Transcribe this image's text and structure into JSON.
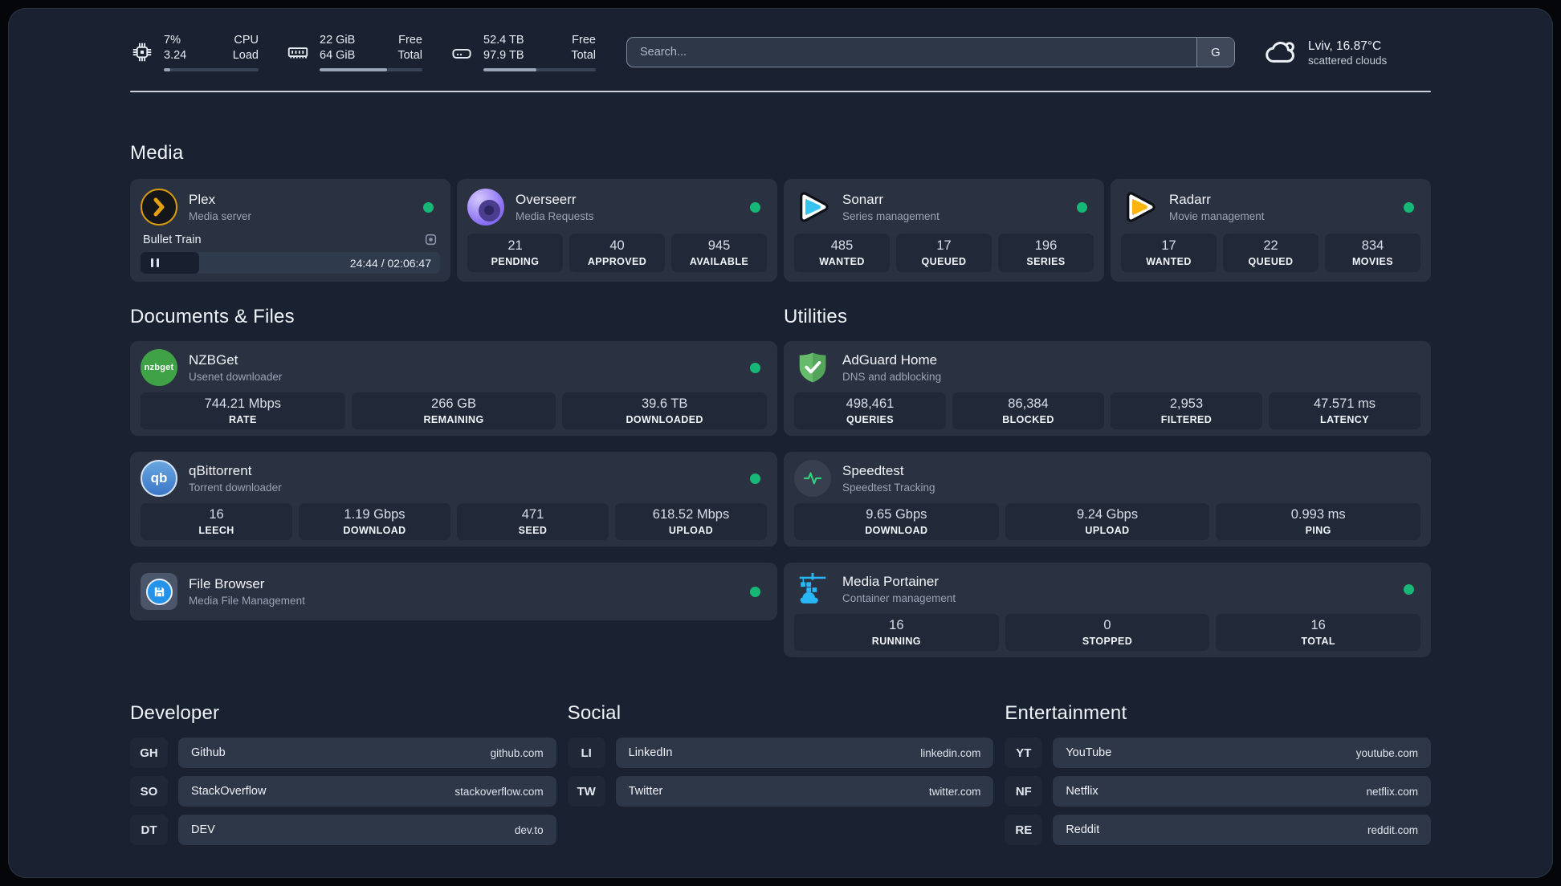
{
  "header": {
    "stats": [
      {
        "icon": "cpu-icon",
        "value_top": "7%",
        "label_top": "CPU",
        "value_bottom": "3.24",
        "label_bottom": "Load",
        "progress": 7
      },
      {
        "icon": "ram-icon",
        "value_top": "22 GiB",
        "label_top": "Free",
        "value_bottom": "64 GiB",
        "label_bottom": "Total",
        "progress": 66
      },
      {
        "icon": "disk-icon",
        "value_top": "52.4 TB",
        "label_top": "Free",
        "value_bottom": "97.9 TB",
        "label_bottom": "Total",
        "progress": 47
      }
    ],
    "search": {
      "placeholder": "Search...",
      "engine_button": "G"
    },
    "weather": {
      "location_temp": "Lviv, 16.87°C",
      "condition": "scattered clouds"
    }
  },
  "media": {
    "title": "Media",
    "plex": {
      "name": "Plex",
      "desc": "Media server",
      "status": "online",
      "now_playing": "Bullet Train",
      "time": "24:44 / 02:06:47",
      "progress": 19.5
    },
    "overseerr": {
      "name": "Overseerr",
      "desc": "Media Requests",
      "status": "online",
      "stats": [
        {
          "value": "21",
          "label": "PENDING"
        },
        {
          "value": "40",
          "label": "APPROVED"
        },
        {
          "value": "945",
          "label": "AVAILABLE"
        }
      ]
    },
    "sonarr": {
      "name": "Sonarr",
      "desc": "Series management",
      "status": "online",
      "stats": [
        {
          "value": "485",
          "label": "WANTED"
        },
        {
          "value": "17",
          "label": "QUEUED"
        },
        {
          "value": "196",
          "label": "SERIES"
        }
      ]
    },
    "radarr": {
      "name": "Radarr",
      "desc": "Movie management",
      "status": "online",
      "stats": [
        {
          "value": "17",
          "label": "WANTED"
        },
        {
          "value": "22",
          "label": "QUEUED"
        },
        {
          "value": "834",
          "label": "MOVIES"
        }
      ]
    }
  },
  "documents": {
    "title": "Documents & Files",
    "nzbget": {
      "name": "NZBGet",
      "desc": "Usenet downloader",
      "status": "online",
      "logo_text": "nzbget",
      "stats": [
        {
          "value": "744.21 Mbps",
          "label": "RATE"
        },
        {
          "value": "266 GB",
          "label": "REMAINING"
        },
        {
          "value": "39.6 TB",
          "label": "DOWNLOADED"
        }
      ]
    },
    "qbittorrent": {
      "name": "qBittorrent",
      "desc": "Torrent downloader",
      "status": "online",
      "logo_text": "qb",
      "stats": [
        {
          "value": "16",
          "label": "LEECH"
        },
        {
          "value": "1.19 Gbps",
          "label": "DOWNLOAD"
        },
        {
          "value": "471",
          "label": "SEED"
        },
        {
          "value": "618.52 Mbps",
          "label": "UPLOAD"
        }
      ]
    },
    "filebrowser": {
      "name": "File Browser",
      "desc": "Media File Management",
      "status": "online"
    }
  },
  "utilities": {
    "title": "Utilities",
    "adguard": {
      "name": "AdGuard Home",
      "desc": "DNS and adblocking",
      "stats": [
        {
          "value": "498,461",
          "label": "QUERIES"
        },
        {
          "value": "86,384",
          "label": "BLOCKED"
        },
        {
          "value": "2,953",
          "label": "FILTERED"
        },
        {
          "value": "47.571 ms",
          "label": "LATENCY"
        }
      ]
    },
    "speedtest": {
      "name": "Speedtest",
      "desc": "Speedtest Tracking",
      "stats": [
        {
          "value": "9.65 Gbps",
          "label": "DOWNLOAD"
        },
        {
          "value": "9.24 Gbps",
          "label": "UPLOAD"
        },
        {
          "value": "0.993 ms",
          "label": "PING"
        }
      ]
    },
    "portainer": {
      "name": "Media Portainer",
      "desc": "Container management",
      "status": "online",
      "stats": [
        {
          "value": "16",
          "label": "RUNNING"
        },
        {
          "value": "0",
          "label": "STOPPED"
        },
        {
          "value": "16",
          "label": "TOTAL"
        }
      ]
    }
  },
  "bookmarks": {
    "developer": {
      "title": "Developer",
      "items": [
        {
          "abbr": "GH",
          "name": "Github",
          "url": "github.com"
        },
        {
          "abbr": "SO",
          "name": "StackOverflow",
          "url": "stackoverflow.com"
        },
        {
          "abbr": "DT",
          "name": "DEV",
          "url": "dev.to"
        }
      ]
    },
    "social": {
      "title": "Social",
      "items": [
        {
          "abbr": "LI",
          "name": "LinkedIn",
          "url": "linkedin.com"
        },
        {
          "abbr": "TW",
          "name": "Twitter",
          "url": "twitter.com"
        }
      ]
    },
    "entertainment": {
      "title": "Entertainment",
      "items": [
        {
          "abbr": "YT",
          "name": "YouTube",
          "url": "youtube.com"
        },
        {
          "abbr": "NF",
          "name": "Netflix",
          "url": "netflix.com"
        },
        {
          "abbr": "RE",
          "name": "Reddit",
          "url": "reddit.com"
        }
      ]
    }
  },
  "colors": {
    "status_online": "#17b877",
    "plex_accent": "#e5a00d",
    "sonarr_accent": "#36c3f2",
    "radarr_accent": "#ffb40b",
    "nzbget_accent": "#40a247",
    "qbittorrent_accent": "#4a84cf",
    "adguard_accent": "#5cb863",
    "overseerr_accent": "#8f76f6",
    "portainer_accent": "#29b6f6",
    "speedtest_pulse": "#2fd07f"
  }
}
